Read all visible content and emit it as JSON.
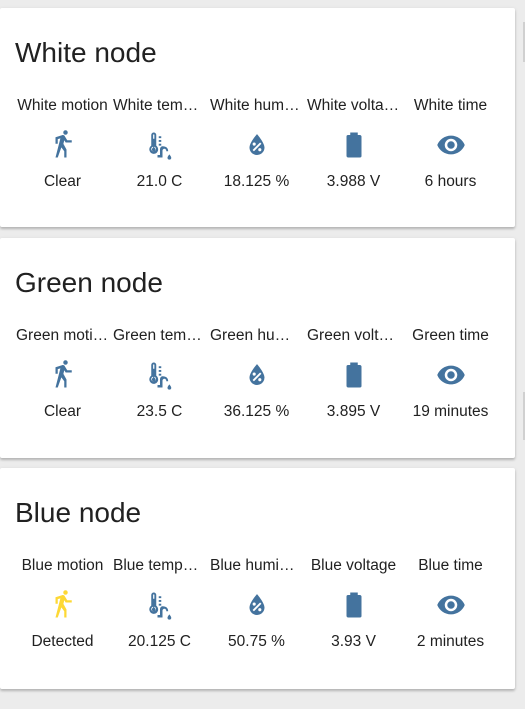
{
  "colors": {
    "icon_default": "#44739e",
    "icon_active": "#fdd835",
    "text": "#212121",
    "card_bg": "#ffffff",
    "page_bg": "#ececec"
  },
  "cards": [
    {
      "title": "White node",
      "entities": [
        {
          "name": "White motion",
          "icon": "walk-icon",
          "state": "Clear",
          "active": false
        },
        {
          "name": "White temperature",
          "icon": "thermometer-water-icon",
          "state": "21.0 C",
          "active": false
        },
        {
          "name": "White humidity",
          "icon": "water-percent-icon",
          "state": "18.125 %",
          "active": false
        },
        {
          "name": "White voltage",
          "icon": "battery-icon",
          "state": "3.988 V",
          "active": false
        },
        {
          "name": "White time",
          "icon": "eye-icon",
          "state": "6 hours",
          "active": false
        }
      ]
    },
    {
      "title": "Green node",
      "entities": [
        {
          "name": "Green motion",
          "icon": "walk-icon",
          "state": "Clear",
          "active": false
        },
        {
          "name": "Green temperature",
          "icon": "thermometer-water-icon",
          "state": "23.5 C",
          "active": false
        },
        {
          "name": "Green humidity",
          "icon": "water-percent-icon",
          "state": "36.125 %",
          "active": false
        },
        {
          "name": "Green voltage",
          "icon": "battery-icon",
          "state": "3.895 V",
          "active": false
        },
        {
          "name": "Green time",
          "icon": "eye-icon",
          "state": "19 minutes",
          "active": false
        }
      ]
    },
    {
      "title": "Blue node",
      "entities": [
        {
          "name": "Blue motion",
          "icon": "walk-icon",
          "state": "Detected",
          "active": true
        },
        {
          "name": "Blue temperature",
          "icon": "thermometer-water-icon",
          "state": "20.125 C",
          "active": false
        },
        {
          "name": "Blue humidity",
          "icon": "water-percent-icon",
          "state": "50.75 %",
          "active": false
        },
        {
          "name": "Blue voltage",
          "icon": "battery-icon",
          "state": "3.93 V",
          "active": false
        },
        {
          "name": "Blue time",
          "icon": "eye-icon",
          "state": "2 minutes",
          "active": false
        }
      ]
    }
  ]
}
